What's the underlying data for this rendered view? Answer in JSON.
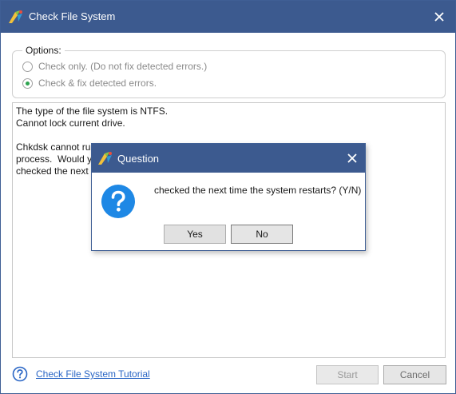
{
  "window": {
    "title": "Check File System",
    "titlebar_color": "#3c5a8f"
  },
  "options": {
    "legend": "Options:",
    "choices": [
      {
        "label": "Check only. (Do not fix detected errors.)",
        "selected": false
      },
      {
        "label": "Check & fix detected errors.",
        "selected": true
      }
    ]
  },
  "console": {
    "lines": [
      "The type of the file system is NTFS.",
      "Cannot lock current drive.",
      "",
      "Chkdsk cannot run because the volume is in use by another",
      "process.  Would you like to schedule this volume to be",
      "checked the next time the system restarts? (Y/N)"
    ]
  },
  "footer": {
    "tutorial_link": "Check File System Tutorial",
    "start_label": "Start",
    "cancel_label": "Cancel"
  },
  "dialog": {
    "title": "Question",
    "message": "checked the next time the system restarts? (Y/N)",
    "yes_label": "Yes",
    "no_label": "No",
    "accent": "#1e88e5"
  }
}
